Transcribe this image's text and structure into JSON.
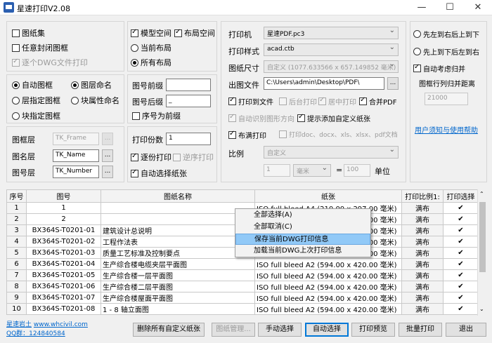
{
  "window": {
    "title": "星速打印V2.08",
    "min": "—",
    "max": "☐",
    "close": "✕"
  },
  "panel1": {
    "frame_set": "图纸集",
    "any_closed_frame": "任意封闭图框",
    "each_dwg": "逐个DWG文件打印"
  },
  "panel2": {
    "model_space": "模型空间",
    "layout_space": "布局空间",
    "current_layout": "当前布局",
    "all_layouts": "所有布局"
  },
  "panel3": {
    "auto_frame": "自动图框",
    "layer_frame": "层指定图框",
    "block_frame": "块指定图框",
    "layer_naming": "图层命名",
    "block_attr_naming": "块属性命名"
  },
  "panel4": {
    "prefix_label": "图号前缀",
    "prefix_value": "",
    "suffix_label": "图号后缀",
    "suffix_value": "_",
    "seq_prefix": "序号为前缀"
  },
  "panel5": {
    "frame_layer_label": "图框层",
    "frame_layer_value": "TK_Frame",
    "name_layer_label": "图名层",
    "name_layer_value": "TK_Name",
    "number_layer_label": "图号层",
    "number_layer_value": "TK_Number",
    "dots": "..."
  },
  "panel6": {
    "copies_label": "打印份数",
    "copies_value": "1",
    "each_copy": "逐份打印",
    "reverse": "逆序打印",
    "auto_paper": "自动选择纸张"
  },
  "panel7": {
    "printer_label": "打印机",
    "printer_value": "星速PDF.pc3",
    "style_label": "打印样式",
    "style_value": "acad.ctb",
    "size_label": "图纸尺寸",
    "size_value": "自定义 (1077.633566 x 657.149852 毫米)",
    "outfile_label": "出图文件",
    "outfile_value": "C:\\Users\\admin\\Desktop\\PDF\\",
    "print_to_file": "打印到文件",
    "background": "后台打印",
    "center": "居中打印",
    "merge": "合并PDF",
    "auto_direction": "自动识别图形方向",
    "hint_custom": "提示添加自定义纸张",
    "fill_print": "布满打印",
    "print_docs": "打印doc、docx、xls、xlsx、pdf文档",
    "scale_label": "比例",
    "scale_value": "自定义",
    "scale_num": "1",
    "scale_unit": "毫米",
    "equals": "=",
    "scale_units_value": "100",
    "unit_label": "单位"
  },
  "panel8": {
    "lr_tb": "先左到右后上到下",
    "tb_lr": "先上到下后左到右",
    "auto_merge": "自动考虑归并",
    "row_merge_label": "图框行列归并距离",
    "row_merge_value": "21000",
    "help_link": "用户须知与使用帮助"
  },
  "table": {
    "headers": [
      "序号",
      "图号",
      "图纸名称",
      "纸张",
      "打印比例1:",
      "打印选择"
    ],
    "rows": [
      {
        "no": "1",
        "num": "1",
        "name": "",
        "paper": "ISO full bleed A4 (210.00 x 297.00 毫米)",
        "scale": "满布",
        "sel": "✔"
      },
      {
        "no": "2",
        "num": "2",
        "name": "",
        "paper": "ISO full bleed A3 (420.00 x 297.00 毫米)",
        "scale": "满布",
        "sel": "✔"
      },
      {
        "no": "3",
        "num": "BX364S-T0201-01",
        "name": "建筑设计总说明",
        "paper": "ISO full bleed A2 (594.00 x 420.00 毫米)",
        "scale": "满布",
        "sel": "✔"
      },
      {
        "no": "4",
        "num": "BX364S-T0201-02",
        "name": "工程作法表",
        "paper": "ISO full bleed A2 (594.00 x 420.00 毫米)",
        "scale": "满布",
        "sel": "✔"
      },
      {
        "no": "5",
        "num": "BX364S-T0201-03",
        "name": "质量工艺标准及控制要点",
        "paper": "ISO full bleed A2 (594.00 x 420.00 毫米)",
        "scale": "满布",
        "sel": "✔"
      },
      {
        "no": "6",
        "num": "BX364S-T0201-04",
        "name": "生产综合楼电缆夹层平面图",
        "paper": "ISO full bleed A2 (594.00 x 420.00 毫米)",
        "scale": "满布",
        "sel": "✔"
      },
      {
        "no": "7",
        "num": "BX364S-T0201-05",
        "name": "生产综合楼一层平面图",
        "paper": "ISO full bleed A2 (594.00 x 420.00 毫米)",
        "scale": "满布",
        "sel": "✔"
      },
      {
        "no": "8",
        "num": "BX364S-T0201-06",
        "name": "生产综合楼二层平面图",
        "paper": "ISO full bleed A2 (594.00 x 420.00 毫米)",
        "scale": "满布",
        "sel": "✔"
      },
      {
        "no": "9",
        "num": "BX364S-T0201-07",
        "name": "生产综合楼屋面平面图",
        "paper": "ISO full bleed A2 (594.00 x 420.00 毫米)",
        "scale": "满布",
        "sel": "✔"
      },
      {
        "no": "10",
        "num": "BX364S-T0201-08",
        "name": "1 - 8 轴立面图",
        "paper": "ISO full bleed A2 (594.00 x 420.00 毫米)",
        "scale": "满布",
        "sel": "✔"
      }
    ]
  },
  "context_menu": {
    "items": [
      "全部选择(A)",
      "全部取消(C)",
      "保存当前DWG打印信息",
      "加载当前DWG上次打印信息"
    ]
  },
  "footer": {
    "brand": "星速岩土",
    "website": "www.whcivil.com",
    "qq": "QQ群：124840584",
    "delete_custom": "删除所有自定义纸张",
    "frame_manage": "图纸管理...",
    "manual_select": "手动选择",
    "auto_select": "自动选择",
    "preview": "打印预览",
    "batch_print": "批量打印",
    "exit": "退出"
  }
}
